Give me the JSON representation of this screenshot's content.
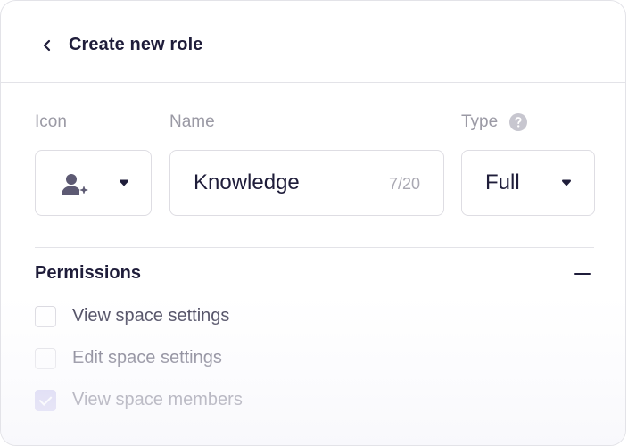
{
  "header": {
    "title": "Create new role"
  },
  "form": {
    "icon_label": "Icon",
    "name_label": "Name",
    "type_label": "Type",
    "name_value": "Knowledge",
    "name_char_count": "7/20",
    "type_value": "Full",
    "icon_value": "person-add-icon"
  },
  "permissions": {
    "title": "Permissions",
    "items": [
      {
        "label": "View space settings",
        "checked": false
      },
      {
        "label": "Edit space settings",
        "checked": false
      },
      {
        "label": "View space members",
        "checked": true
      }
    ]
  },
  "colors": {
    "text_primary": "#1f1d3a",
    "text_muted": "#9b9aa5",
    "border": "#dedde3",
    "checkbox_checked": "#b9b4ea"
  }
}
